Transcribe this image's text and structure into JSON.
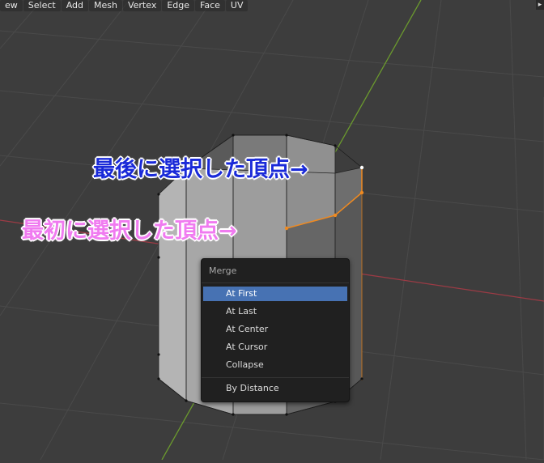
{
  "menubar": {
    "items": [
      "ew",
      "Select",
      "Add",
      "Mesh",
      "Vertex",
      "Edge",
      "Face",
      "UV"
    ]
  },
  "annotations": {
    "last_selected": "最後に選択した頂点→",
    "first_selected": "最初に選択した頂点→"
  },
  "merge_menu": {
    "title": "Merge",
    "items": [
      "At First",
      "At Last",
      "At Center",
      "At Cursor",
      "Collapse"
    ],
    "extra_item": "By Distance",
    "active_item": "At First"
  },
  "colors": {
    "background": "#3d3d3d",
    "grid": "#4a4a4a",
    "x_axis": "#9c3b45",
    "y_axis": "#6b9a2e",
    "selection": "#f08a20",
    "menu_highlight": "#4772b3",
    "annotation_last": "#1a2ad8",
    "annotation_first": "#f07bf0"
  }
}
